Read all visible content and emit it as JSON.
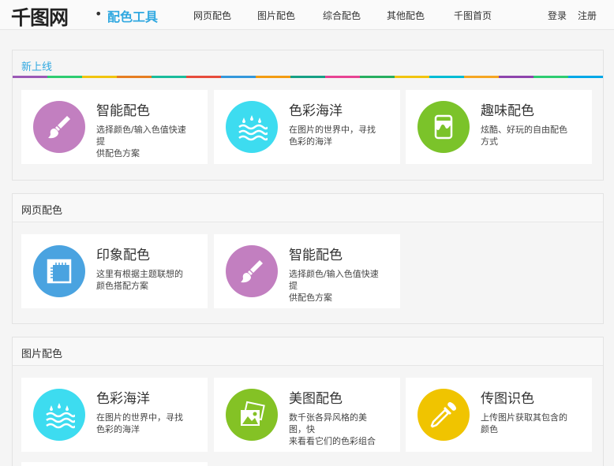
{
  "header": {
    "logo": "千图网",
    "dot": "•",
    "tool_name": "配色工具",
    "nav": [
      "网页配色",
      "图片配色",
      "综合配色",
      "其他配色",
      "千图首页"
    ],
    "login": "登录",
    "register": "注册"
  },
  "sections": [
    {
      "title": "新上线",
      "rainbow": [
        "#9b59b6",
        "#2ecc71",
        "#f1c40f",
        "#e67e22",
        "#1abc9c",
        "#e74c3c",
        "#3498db",
        "#f39c12",
        "#16a085",
        "#e84393",
        "#27ae60",
        "#f1c40f",
        "#00bcd4",
        "#f5a623",
        "#8e44ad",
        "#2ecc71",
        "#00a8e8"
      ],
      "cards": [
        {
          "title": "智能配色",
          "desc": "选择颜色/输入色值快速\n提\n供配色方案",
          "color": "#c27fc0",
          "icon": "brush-icon"
        },
        {
          "title": "色彩海洋",
          "desc": "在图片的世界中，寻找\n色彩的海洋",
          "color": "#3ddcf0",
          "icon": "waves-icon"
        },
        {
          "title": "趣味配色",
          "desc": "炫酷、好玩的自由配色\n方式",
          "color": "#7bc32a",
          "icon": "paint-bucket-icon"
        }
      ]
    },
    {
      "title": "网页配色",
      "cards": [
        {
          "title": "印象配色",
          "desc": "这里有根据主题联想的\n颜色搭配方案",
          "color": "#4aa3e0",
          "icon": "ruler-icon"
        },
        {
          "title": "智能配色",
          "desc": "选择颜色/输入色值快速\n提\n供配色方案",
          "color": "#c27fc0",
          "icon": "brush-icon"
        }
      ]
    },
    {
      "title": "图片配色",
      "cards": [
        {
          "title": "色彩海洋",
          "desc": "在图片的世界中，寻找\n色彩的海洋",
          "color": "#3ddcf0",
          "icon": "waves-icon"
        },
        {
          "title": "美图配色",
          "desc": "数千张各异风格的美\n图，快\n来看看它们的色彩组合",
          "color": "#84c225",
          "icon": "pictures-icon"
        },
        {
          "title": "传图识色",
          "desc": "上传图片获取其包含的\n颜色",
          "color": "#f0c400",
          "icon": "dropper-icon"
        }
      ]
    }
  ]
}
